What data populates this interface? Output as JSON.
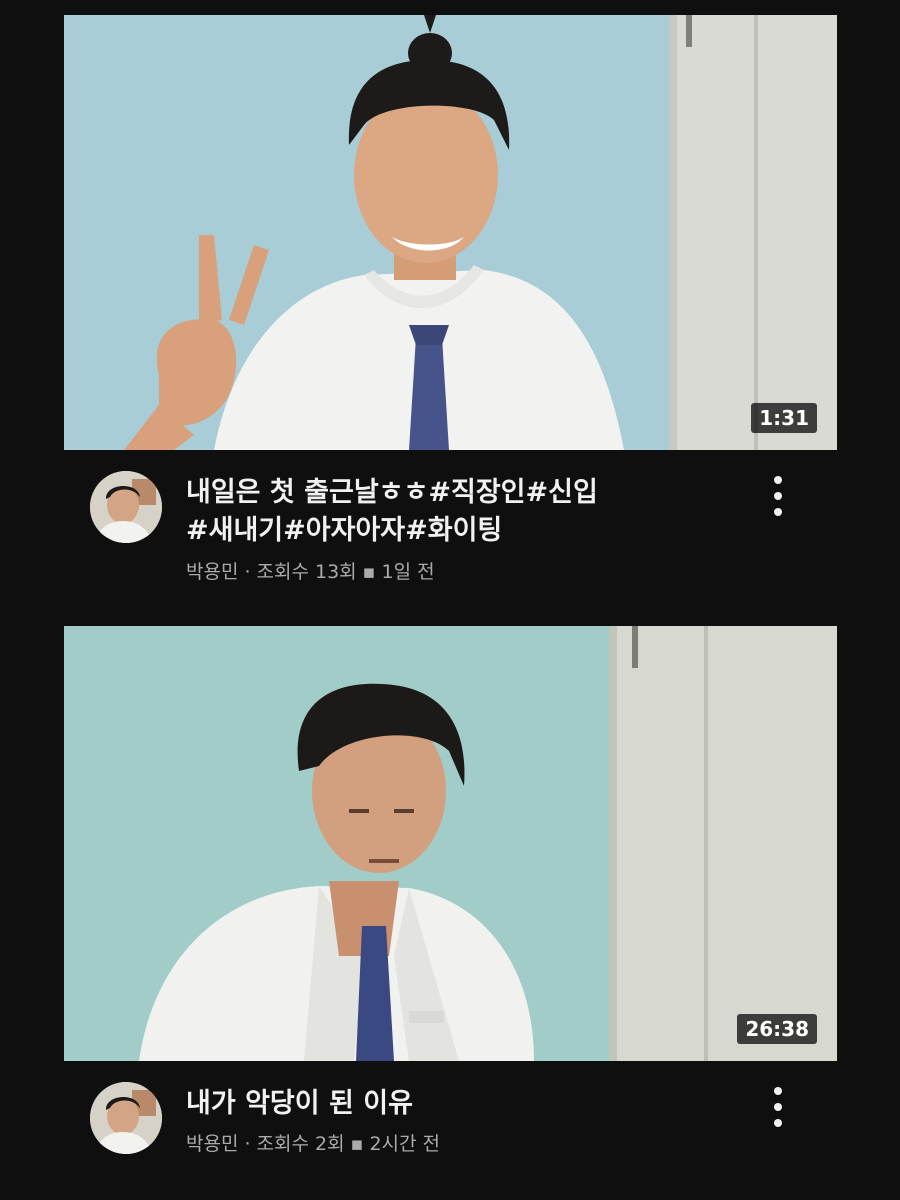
{
  "videos": [
    {
      "duration": "1:31",
      "title_line1": "내일은 첫 출근날ㅎㅎ#직장인#신입",
      "title_line2": "#새내기#아자아자#화이팅",
      "channel": "박용민",
      "views": "조회수 13회",
      "age": "1일 전",
      "meta_dot": "·",
      "meta_square": "▪"
    },
    {
      "duration": "26:38",
      "title_line1": "내가 악당이 된 이유",
      "channel": "박용민",
      "views": "조회수 2회",
      "age": "2시간 전",
      "meta_dot": "·",
      "meta_square": "▪"
    }
  ],
  "icons": {
    "more": "more-vertical-icon"
  },
  "colors": {
    "background": "#0f0f0f",
    "title": "#f1f1f1",
    "meta": "#aaaaaa",
    "wall": "#a9cfd6"
  }
}
